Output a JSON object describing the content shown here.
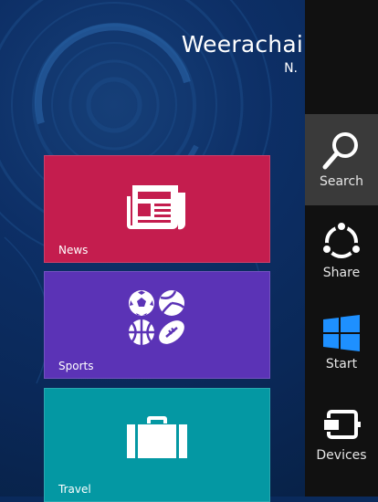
{
  "user": {
    "name": "Weerachai",
    "initial": "N."
  },
  "tiles": [
    {
      "label": "News",
      "icon": "newspaper-icon",
      "color": "#c41d4e"
    },
    {
      "label": "Sports",
      "icon": "sports-balls-icon",
      "color": "#5b33b6"
    },
    {
      "label": "Travel",
      "icon": "suitcase-icon",
      "color": "#0498a3"
    }
  ],
  "charms": [
    {
      "label": "Search",
      "icon": "search-icon",
      "active": true
    },
    {
      "label": "Share",
      "icon": "share-icon",
      "active": false
    },
    {
      "label": "Start",
      "icon": "windows-logo-icon",
      "active": false
    },
    {
      "label": "Devices",
      "icon": "devices-icon",
      "active": false
    }
  ],
  "colors": {
    "background": "#0a2a5c",
    "charms_bar": "#111111",
    "charm_active": "#3a3a3a",
    "windows_logo": "#1e90ff"
  }
}
